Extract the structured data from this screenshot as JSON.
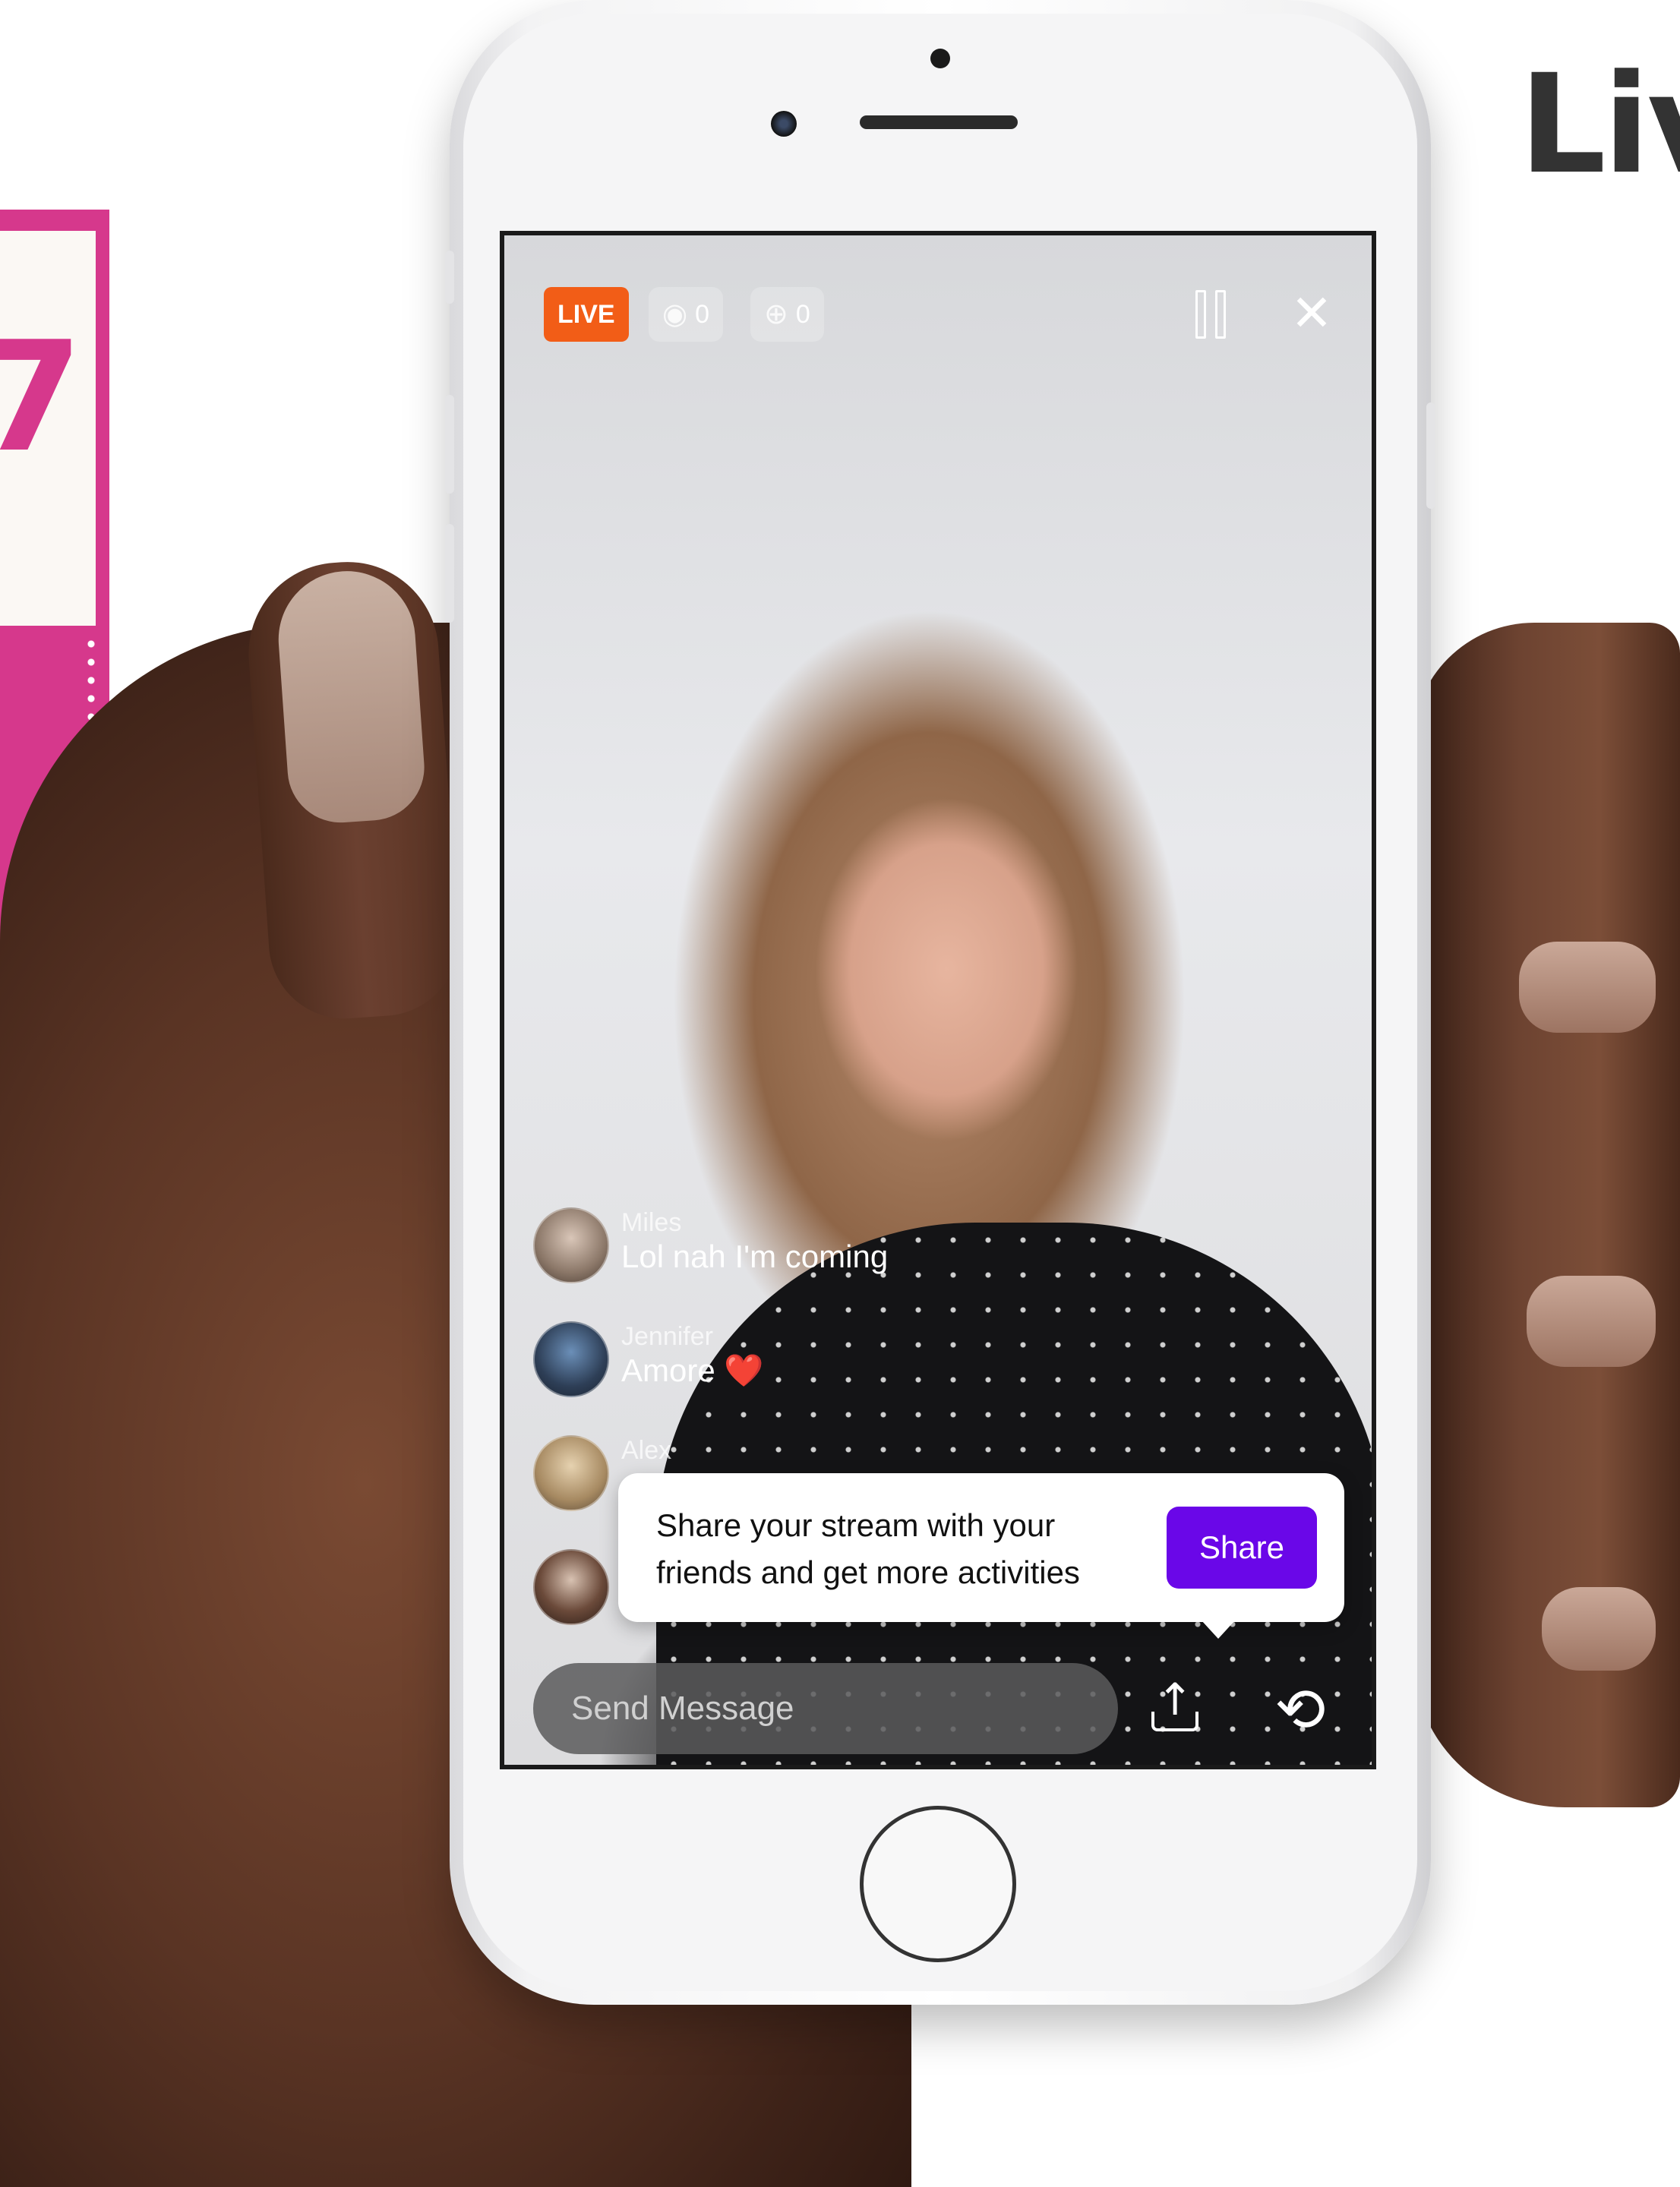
{
  "headline": {
    "text": "Liv"
  },
  "stamp": {
    "glyph": "7"
  },
  "stream": {
    "live_label": "LIVE",
    "viewers_count": "0",
    "activity_count": "0",
    "icons": {
      "viewers": "eye-icon",
      "activity": "sparkle-icon",
      "pause": "pause-icon",
      "close": "close-icon"
    }
  },
  "comments": [
    {
      "user": "Miles",
      "message": "Lol nah I'm coming",
      "emoji": ""
    },
    {
      "user": "Jennifer",
      "message": "Amore",
      "emoji": "❤️"
    },
    {
      "user": "Alex",
      "message": "",
      "emoji": ""
    }
  ],
  "share_popup": {
    "text": "Share your stream with your friends and get more activities",
    "button_label": "Share"
  },
  "bottom_bar": {
    "message_placeholder": "Send Message",
    "icons": {
      "share": "upload-icon",
      "flip": "camera-flip-icon"
    }
  },
  "colors": {
    "live_badge": "#f25d17",
    "share_button": "#6a07e8",
    "stamp": "#d6388c"
  }
}
